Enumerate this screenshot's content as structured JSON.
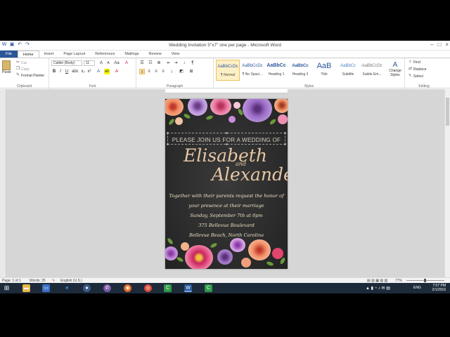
{
  "window": {
    "title": "Wedding Invitation 5\"x7\" one per page - Microsoft Word"
  },
  "tabs": [
    "File",
    "Home",
    "Insert",
    "Page Layout",
    "References",
    "Mailings",
    "Review",
    "View"
  ],
  "ribbon": {
    "clipboard": {
      "paste": "Paste",
      "cut": "Cut",
      "copy": "Copy",
      "format_painter": "Format Painter",
      "label": "Clipboard"
    },
    "font": {
      "name": "Calibri (Body)",
      "size": "11",
      "label": "Font"
    },
    "paragraph": {
      "label": "Paragraph"
    },
    "styles": {
      "label": "Styles",
      "items": [
        {
          "preview": "AaBbCcDc",
          "name": "¶ Normal"
        },
        {
          "preview": "AaBbCcDc",
          "name": "¶ No Spaci..."
        },
        {
          "preview": "AaBbCc",
          "name": "Heading 1"
        },
        {
          "preview": "AaBbCc",
          "name": "Heading 2"
        },
        {
          "preview": "AaB",
          "name": "Title"
        },
        {
          "preview": "AaBbCc",
          "name": "Subtitle"
        },
        {
          "preview": "AaBbCcDc",
          "name": "Subtle Em..."
        }
      ],
      "change_styles": "Change Styles"
    },
    "editing": {
      "find": "Find",
      "replace": "Replace",
      "select": "Select",
      "label": "Editing"
    }
  },
  "document": {
    "invite_line": "PLEASE JOIN US FOR A WEDDING OF",
    "name1": "Elisabeth",
    "and": "and",
    "name2": "Alexander",
    "lines": [
      "Together with their parents request the honor of",
      "your presence at their marriage",
      "Sunday, September 7th at 6pm",
      "375 Bellevue Boulevard",
      "Bellevue Beach, North Carolina"
    ]
  },
  "status": {
    "page": "Page: 1 of 1",
    "words": "Words: 35",
    "language": "English (U.S.)",
    "zoom": "77%"
  },
  "clock": {
    "time": "7:07 PM",
    "date": "2/1/2016"
  }
}
